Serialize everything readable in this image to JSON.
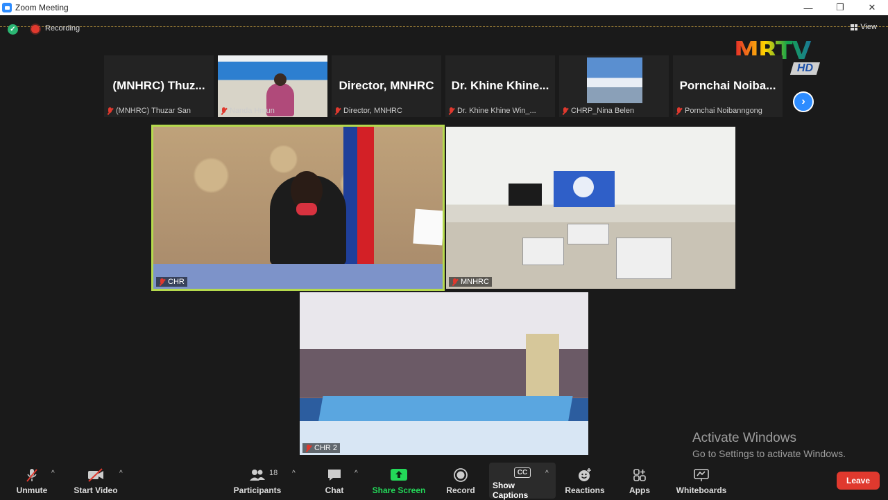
{
  "window": {
    "title": "Zoom Meeting",
    "minimize": "—",
    "restore": "❐",
    "close": "✕"
  },
  "status": {
    "recording_label": "Recording",
    "view_label": "View"
  },
  "broadcaster": {
    "logo_text": "MRTV",
    "logo_badge": "HD"
  },
  "thumbnails": [
    {
      "display": "(MNHRC)  Thuz...",
      "label": "(MNHRC) Thuzar San"
    },
    {
      "display": "",
      "label": "Nanda Hmun"
    },
    {
      "display": "Director, MNHRC",
      "label": "Director, MNHRC"
    },
    {
      "display": "Dr. Khine Khine...",
      "label": "Dr. Khine Khine Win_..."
    },
    {
      "display": "",
      "label": "CHRP_Nina Belen"
    },
    {
      "display": "Pornchai  Noiba...",
      "label": "Pornchai Noibanngong"
    }
  ],
  "next_icon": "›",
  "tiles": [
    {
      "name": "CHR",
      "active_speaker": true
    },
    {
      "name": "MNHRC"
    },
    {
      "name": "CHR 2"
    }
  ],
  "watermark": {
    "title": "Activate Windows",
    "subtitle": "Go to Settings to activate Windows."
  },
  "toolbar": {
    "unmute": "Unmute",
    "start_video": "Start Video",
    "participants": "Participants",
    "participants_count": "18",
    "chat": "Chat",
    "share_screen": "Share Screen",
    "record": "Record",
    "show_captions": "Show Captions",
    "captions_icon": "CC",
    "reactions": "Reactions",
    "apps": "Apps",
    "whiteboards": "Whiteboards",
    "leave": "Leave",
    "caret": "^"
  },
  "colors": {
    "accent": "#2d8cff",
    "share": "#23d959",
    "leave": "#e0392e",
    "speaker_border": "#b5d94d"
  }
}
